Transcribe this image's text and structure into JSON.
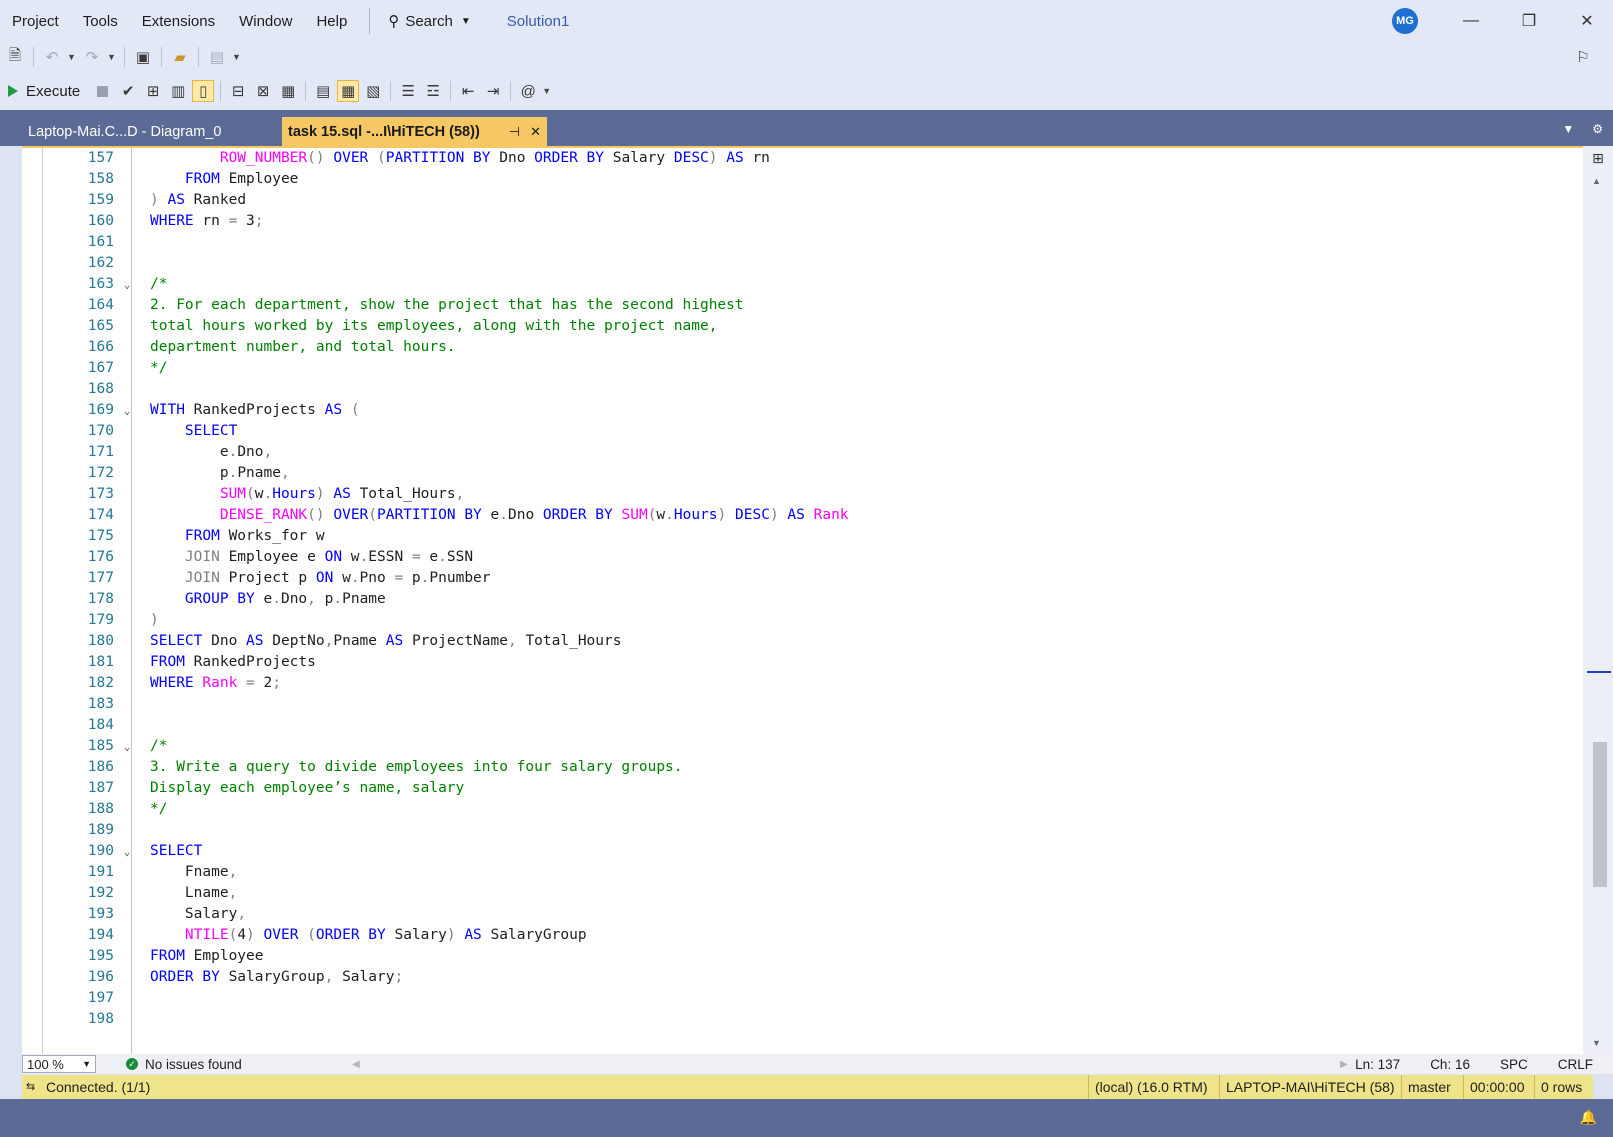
{
  "menu": {
    "items": [
      "Project",
      "Tools",
      "Extensions",
      "Window",
      "Help"
    ],
    "search_label": "Search",
    "solution": "Solution1",
    "avatar_initials": "MG"
  },
  "toolbar": {
    "execute_label": "Execute"
  },
  "tabs": {
    "inactive_label": "Laptop-Mai.C...D - Diagram_0",
    "active_label": "task 15.sql -...I\\HiTECH (58))"
  },
  "editor": {
    "lines": [
      {
        "n": "157",
        "fold": "",
        "html": "        <span class=\"fn\">ROW_NUMBER</span><span class=\"gr\">()</span> <span class=\"kw\">OVER</span> <span class=\"gr\">(</span><span class=\"kw\">PARTITION BY</span> Dno <span class=\"kw\">ORDER BY</span> Salary <span class=\"kw\">DESC</span><span class=\"gr\">)</span> <span class=\"kw\">AS</span> rn"
      },
      {
        "n": "158",
        "fold": "",
        "html": "    <span class=\"kw\">FROM</span> Employee"
      },
      {
        "n": "159",
        "fold": "",
        "html": "<span class=\"gr\">)</span> <span class=\"kw\">AS</span> Ranked"
      },
      {
        "n": "160",
        "fold": "",
        "html": "<span class=\"kw\">WHERE</span> rn <span class=\"gr\">=</span> 3<span class=\"gr\">;</span>"
      },
      {
        "n": "161",
        "fold": "",
        "html": ""
      },
      {
        "n": "162",
        "fold": "",
        "html": ""
      },
      {
        "n": "163",
        "fold": "v",
        "html": "<span class=\"cm\">/*</span>"
      },
      {
        "n": "164",
        "fold": "",
        "html": "<span class=\"cm\">2. For each department, show the project that has the second highest</span>"
      },
      {
        "n": "165",
        "fold": "",
        "html": "<span class=\"cm\">total hours worked by its employees, along with the project name,</span>"
      },
      {
        "n": "166",
        "fold": "",
        "html": "<span class=\"cm\">department number, and total hours.</span>"
      },
      {
        "n": "167",
        "fold": "",
        "html": "<span class=\"cm\">*/</span>"
      },
      {
        "n": "168",
        "fold": "",
        "html": ""
      },
      {
        "n": "169",
        "fold": "v",
        "html": "<span class=\"kw\">WITH</span> RankedProjects <span class=\"kw\">AS</span> <span class=\"gr\">(</span>"
      },
      {
        "n": "170",
        "fold": "",
        "html": "    <span class=\"kw\">SELECT</span>"
      },
      {
        "n": "171",
        "fold": "",
        "html": "        e<span class=\"gr\">.</span>Dno<span class=\"gr\">,</span>"
      },
      {
        "n": "172",
        "fold": "",
        "html": "        p<span class=\"gr\">.</span>Pname<span class=\"gr\">,</span>"
      },
      {
        "n": "173",
        "fold": "",
        "html": "        <span class=\"fn\">SUM</span><span class=\"gr\">(</span>w<span class=\"gr\">.</span><span class=\"kw\">Hours</span><span class=\"gr\">)</span> <span class=\"kw\">AS</span> Total_Hours<span class=\"gr\">,</span>"
      },
      {
        "n": "174",
        "fold": "",
        "html": "        <span class=\"fn\">DENSE_RANK</span><span class=\"gr\">()</span> <span class=\"kw\">OVER</span><span class=\"gr\">(</span><span class=\"kw\">PARTITION BY</span> e<span class=\"gr\">.</span>Dno <span class=\"kw\">ORDER BY</span> <span class=\"fn\">SUM</span><span class=\"gr\">(</span>w<span class=\"gr\">.</span><span class=\"kw\">Hours</span><span class=\"gr\">)</span> <span class=\"kw\">DESC</span><span class=\"gr\">)</span> <span class=\"kw\">AS</span> <span class=\"fn\">Rank</span>"
      },
      {
        "n": "175",
        "fold": "",
        "html": "    <span class=\"kw\">FROM</span> Works_for w"
      },
      {
        "n": "176",
        "fold": "",
        "html": "    <span class=\"gr\">JOIN</span> Employee e <span class=\"kw\">ON</span> w<span class=\"gr\">.</span>ESSN <span class=\"gr\">=</span> e<span class=\"gr\">.</span>SSN"
      },
      {
        "n": "177",
        "fold": "",
        "html": "    <span class=\"gr\">JOIN</span> Project p <span class=\"kw\">ON</span> w<span class=\"gr\">.</span>Pno <span class=\"gr\">=</span> p<span class=\"gr\">.</span>Pnumber"
      },
      {
        "n": "178",
        "fold": "",
        "html": "    <span class=\"kw\">GROUP BY</span> e<span class=\"gr\">.</span>Dno<span class=\"gr\">,</span> p<span class=\"gr\">.</span>Pname"
      },
      {
        "n": "179",
        "fold": "",
        "html": "<span class=\"gr\">)</span>"
      },
      {
        "n": "180",
        "fold": "",
        "html": "<span class=\"kw\">SELECT</span> Dno <span class=\"kw\">AS</span> DeptNo<span class=\"gr\">,</span>Pname <span class=\"kw\">AS</span> ProjectName<span class=\"gr\">,</span> Total_Hours"
      },
      {
        "n": "181",
        "fold": "",
        "html": "<span class=\"kw\">FROM</span> RankedProjects"
      },
      {
        "n": "182",
        "fold": "",
        "html": "<span class=\"kw\">WHERE</span> <span class=\"fn\">Rank</span> <span class=\"gr\">=</span> 2<span class=\"gr\">;</span>"
      },
      {
        "n": "183",
        "fold": "",
        "html": ""
      },
      {
        "n": "184",
        "fold": "",
        "html": ""
      },
      {
        "n": "185",
        "fold": "v",
        "html": "<span class=\"cm\">/*</span>"
      },
      {
        "n": "186",
        "fold": "",
        "html": "<span class=\"cm\">3. Write a query to divide employees into four salary groups.</span>"
      },
      {
        "n": "187",
        "fold": "",
        "html": "<span class=\"cm\">Display each employee’s name, salary</span>"
      },
      {
        "n": "188",
        "fold": "",
        "html": "<span class=\"cm\">*/</span>"
      },
      {
        "n": "189",
        "fold": "",
        "html": ""
      },
      {
        "n": "190",
        "fold": "v",
        "html": "<span class=\"kw\">SELECT</span>"
      },
      {
        "n": "191",
        "fold": "",
        "html": "    Fname<span class=\"gr\">,</span>"
      },
      {
        "n": "192",
        "fold": "",
        "html": "    Lname<span class=\"gr\">,</span>"
      },
      {
        "n": "193",
        "fold": "",
        "html": "    Salary<span class=\"gr\">,</span>"
      },
      {
        "n": "194",
        "fold": "",
        "html": "    <span class=\"fn\">NTILE</span><span class=\"gr\">(</span>4<span class=\"gr\">)</span> <span class=\"kw\">OVER</span> <span class=\"gr\">(</span><span class=\"kw\">ORDER BY</span> Salary<span class=\"gr\">)</span> <span class=\"kw\">AS</span> SalaryGroup"
      },
      {
        "n": "195",
        "fold": "",
        "html": "<span class=\"kw\">FROM</span> Employee"
      },
      {
        "n": "196",
        "fold": "",
        "html": "<span class=\"kw\">ORDER BY</span> SalaryGroup<span class=\"gr\">,</span> Salary<span class=\"gr\">;</span>"
      },
      {
        "n": "197",
        "fold": "",
        "html": ""
      },
      {
        "n": "198",
        "fold": "",
        "html": ""
      }
    ]
  },
  "editor_status": {
    "zoom": "100 %",
    "issues": "No issues found",
    "ln": "Ln: 137",
    "ch": "Ch: 16",
    "spc": "SPC",
    "crlf": "CRLF"
  },
  "connection": {
    "status": "Connected. (1/1)",
    "server": "(local) (16.0 RTM)",
    "login": "LAPTOP-MAI\\HiTECH (58)",
    "database": "master",
    "elapsed": "00:00:00",
    "rows": "0 rows"
  }
}
